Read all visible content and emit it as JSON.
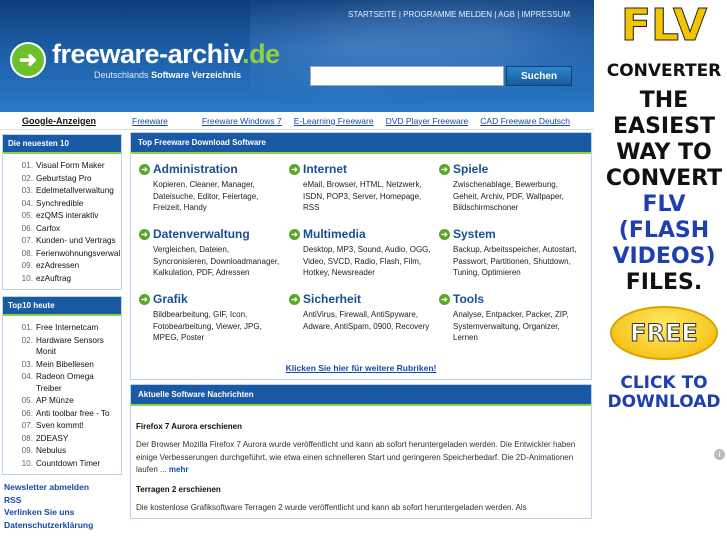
{
  "header": {
    "top_links": "STARTSEITE | PROGRAMME MELDEN | AGB | IMPRESSUM",
    "logo_main": "freeware-archiv",
    "logo_tld": ".de",
    "logo_sub_prefix": "Deutschlands",
    "logo_sub_bold": "Software Verzeichnis",
    "search_value": "",
    "search_button": "Suchen"
  },
  "linkbar": {
    "google_ads": "Google-Anzeigen",
    "links": [
      "Freeware",
      "Freeware Windows 7",
      "E-Learning Freeware",
      "DVD Player Freeware",
      "CAD Freeware Deutsch"
    ]
  },
  "sidebar": {
    "newest_title": "Die neuesten 10",
    "newest": [
      {
        "n": "01.",
        "t": "Visual Form Maker"
      },
      {
        "n": "02.",
        "t": "Geburtstag Pro"
      },
      {
        "n": "03.",
        "t": "Edelmetallverwaltung"
      },
      {
        "n": "04.",
        "t": "Synchredible"
      },
      {
        "n": "05.",
        "t": "ezQMS interaktiv"
      },
      {
        "n": "06.",
        "t": "Carfox"
      },
      {
        "n": "07.",
        "t": "Kunden- und Vertrags"
      },
      {
        "n": "08.",
        "t": "Ferienwohnungsverwal"
      },
      {
        "n": "09.",
        "t": "ezAdressen"
      },
      {
        "n": "10.",
        "t": "ezAuftrag"
      }
    ],
    "top10_title": "Top10 heute",
    "top10": [
      {
        "n": "01.",
        "t": "Free Internetcam"
      },
      {
        "n": "02.",
        "t": "Hardware Sensors Monit"
      },
      {
        "n": "03.",
        "t": "Mein Bibellesen"
      },
      {
        "n": "04.",
        "t": "Radeon Omega Treiber"
      },
      {
        "n": "05.",
        "t": "AP Münze"
      },
      {
        "n": "06.",
        "t": "Anti toolbar free - To"
      },
      {
        "n": "07.",
        "t": "Sven kommt!"
      },
      {
        "n": "08.",
        "t": "2DEASY"
      },
      {
        "n": "09.",
        "t": "Nebulus"
      },
      {
        "n": "10.",
        "t": "Countdown Timer"
      }
    ],
    "links": [
      "Newsletter abmelden",
      "RSS",
      "Verlinken Sie uns",
      "Datenschutzerklärung"
    ]
  },
  "main": {
    "top_title": "Top Freeware Download Software",
    "categories": [
      {
        "title": "Administration",
        "desc": "Kopieren, Cleaner, Manager, Dateisuche, Editor, Feiertage, Freizeit, Handy"
      },
      {
        "title": "Internet",
        "desc": "eMail, Browser, HTML, Netzwerk, ISDN, POP3, Server, Homepage, RSS"
      },
      {
        "title": "Spiele",
        "desc": "Zwischenablage, Bewerbung, Geheit, Archiv, PDF, Wallpaper, Bildschirmschoner"
      },
      {
        "title": "Datenverwaltung",
        "desc": "Vergleichen, Dateien, Syncronisieren, Downloadmanager, Kalkulation, PDF, Adressen"
      },
      {
        "title": "Multimedia",
        "desc": "Desktop, MP3, Sound, Audio, OGG, Video, SVCD, Radio, Flash, Film, Hotkey, Newsreader"
      },
      {
        "title": "System",
        "desc": "Backup, Arbeitsspeicher, Autostart, Passwort, Partitionen, Shutdown, Tuning, Optimieren"
      },
      {
        "title": "Grafik",
        "desc": "Bildbearbeitung, GIF, Icon, Fotobearbeitung, Viewer, JPG, MPEG, Poster"
      },
      {
        "title": "Sicherheit",
        "desc": "AntiVirus, Firewall, AntiSpyware, Adware, AntiSpam, 0900, Recovery"
      },
      {
        "title": "Tools",
        "desc": "Analyse, Entpacker, Packer, ZIP, Systemverwaltung, Organizer, Lernen"
      }
    ],
    "more_rubrics": "Klicken Sie hier für weitere Rubriken!",
    "news_title": "Aktuelle Software Nachrichten",
    "news": [
      {
        "title": "Firefox 7 Aurora erschienen",
        "text": "Der Browser Mozilla Firefox 7 Aurora wurde veröffentlicht und kann ab sofort heruntergeladen werden. Die Entwickler haben einige Verbesserungen durchgeführt, wie etwa einen schnelleren Start und geringeren Speicherbedarf. Die 2D-Animationen laufen ...",
        "more": "mehr"
      },
      {
        "title": "Terragen 2 erschienen",
        "text": "Die kostenlose Grafiksoftware Terragen 2 wurde veröffentlicht und kann ab sofort heruntergeladen werden. Als",
        "more": ""
      }
    ]
  },
  "ad": {
    "line1": "FLV",
    "line2": "CONVERTER",
    "line3": "THE EASIEST WAY TO CONVERT",
    "line4": "FLV (FLASH VIDEOS)",
    "line5": "FILES.",
    "free": "FREE",
    "click": "CLICK TO DOWNLOAD",
    "info_icon": "i"
  },
  "colors": {
    "header_blue": "#1c5ea8",
    "box_head": "#1a5aa5",
    "accent_green": "#8fd13f",
    "link": "#1748a8",
    "ad_yellow": "#f2c500"
  }
}
